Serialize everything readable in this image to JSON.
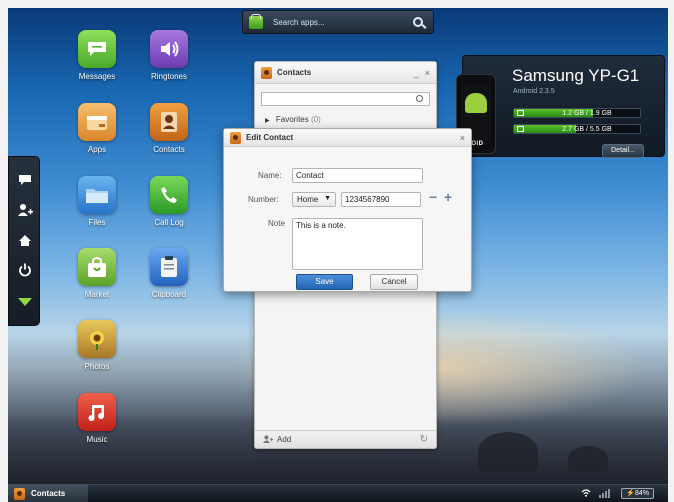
{
  "search": {
    "placeholder": "Search apps..."
  },
  "desktop_apps": [
    {
      "label": "Messages",
      "icon": "speech-bubble-icon",
      "color": "#6cc83a"
    },
    {
      "label": "Ringtones",
      "icon": "speaker-icon",
      "color": "#8a5cc8"
    },
    {
      "label": "Apps",
      "icon": "package-icon",
      "color": "#e89a3a"
    },
    {
      "label": "Contacts",
      "icon": "contact-card-icon",
      "color": "#e07a2a"
    },
    {
      "label": "Files",
      "icon": "folder-icon",
      "color": "#3a8ee0"
    },
    {
      "label": "Call Log",
      "icon": "phone-icon",
      "color": "#44b840"
    },
    {
      "label": "Market",
      "icon": "market-bag-icon",
      "color": "#7cc23c"
    },
    {
      "label": "Clipboard",
      "icon": "clipboard-icon",
      "color": "#3a7ee0"
    },
    {
      "label": "Photos",
      "icon": "photo-sunflower-icon",
      "color": "#c8a23a"
    },
    {
      "label": "Music",
      "icon": "music-note-icon",
      "color": "#e03a2a"
    }
  ],
  "dock": [
    "chat-icon",
    "add-contact-icon",
    "home-icon",
    "power-icon",
    "collapse-down-icon"
  ],
  "device": {
    "name": "Samsung YP-G1",
    "os": "Android 2.3.5",
    "phone_brand": "ANDROID",
    "storage": [
      {
        "text": "1.2 GB / 1.9 GB",
        "fill": 0.63
      },
      {
        "text": "2.7 GB / 5.5 GB",
        "fill": 0.49
      }
    ],
    "detail_label": "Detail..."
  },
  "contacts_window": {
    "title": "Contacts",
    "minimize": "_",
    "close": "×",
    "favorites_label": "Favorites",
    "favorites_count": "(0)",
    "add_label": "Add",
    "refresh": "↻"
  },
  "edit_dialog": {
    "title": "Edit Contact",
    "close": "×",
    "name_label": "Name:",
    "name_value": "Contact",
    "number_label": "Number:",
    "number_type": "Home",
    "number_value": "1234567890",
    "note_label": "Note",
    "note_value": "This is a note.",
    "save_label": "Save",
    "cancel_label": "Cancel",
    "minus": "−",
    "plus": "+"
  },
  "taskbar": {
    "task_label": "Contacts",
    "battery": "84%"
  }
}
